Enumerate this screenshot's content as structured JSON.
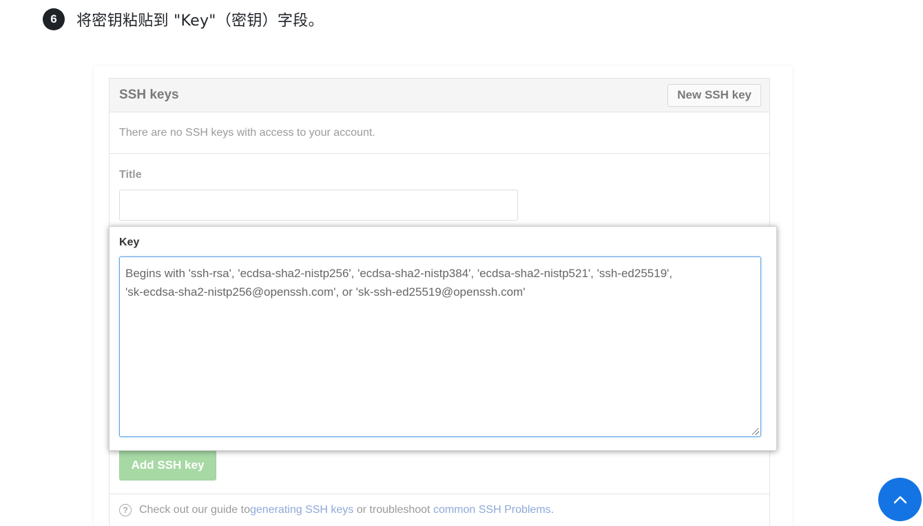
{
  "step": {
    "number": "6",
    "text": "将密钥粘贴到 \"Key\"（密钥）字段。"
  },
  "ssh_panel": {
    "title": "SSH keys",
    "new_key_button": "New SSH key",
    "empty_message": "There are no SSH keys with access to your account.",
    "title_label": "Title",
    "title_value": "",
    "key_label": "Key",
    "key_placeholder_line1": "Begins with 'ssh-rsa', 'ecdsa-sha2-nistp256', 'ecdsa-sha2-nistp384', 'ecdsa-sha2-nistp521', 'ssh-ed25519',",
    "key_placeholder_line2": "'sk-ecdsa-sha2-nistp256@openssh.com', or 'sk-ssh-ed25519@openssh.com'",
    "add_button": "Add SSH key",
    "help": {
      "icon": "question-circle-icon",
      "text_before": "Check out our guide to ",
      "link1": "generating SSH keys",
      "text_middle": " or troubleshoot ",
      "link2": "common SSH Problems",
      "text_after": "."
    }
  },
  "scroll_top": {
    "icon": "chevron-up-icon"
  },
  "colors": {
    "accent": "#1474e4",
    "textarea_focus": "#5aa0e6",
    "add_button": "#a7d9a4",
    "link": "#8ea8d8"
  }
}
